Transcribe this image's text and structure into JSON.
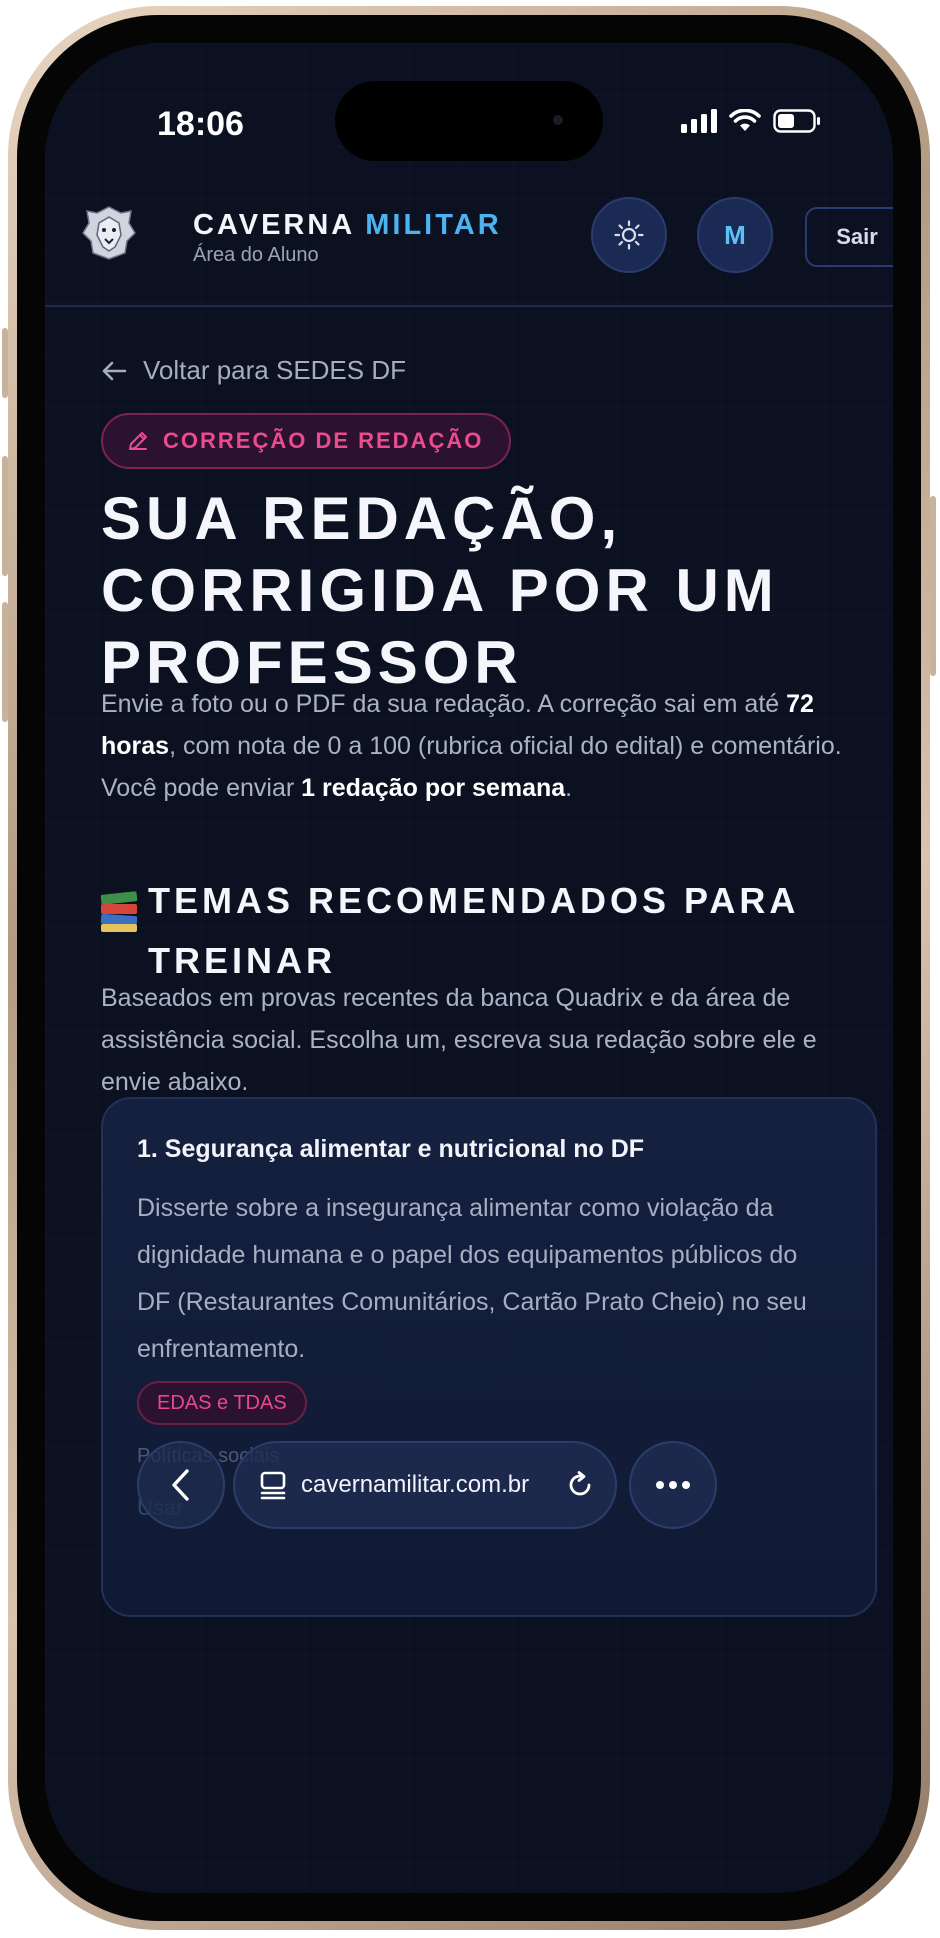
{
  "status_bar": {
    "time": "18:06"
  },
  "header": {
    "brand_part1": "CAVERNA",
    "brand_part2": "MILITAR",
    "subtitle": "Área do Aluno",
    "avatar_initial": "M",
    "logout_label": "Sair"
  },
  "back_link": {
    "label": "Voltar para SEDES DF"
  },
  "tag": {
    "label": "CORREÇÃO DE REDAÇÃO"
  },
  "title": {
    "line1": "SUA REDAÇÃO,",
    "line2": "CORRIGIDA POR UM",
    "line3": "PROFESSOR"
  },
  "intro": {
    "part1": "Envie a foto ou o PDF da sua redação. A correção sai em até ",
    "bold1": "72 horas",
    "part2": ", com nota de 0 a 100 (rubrica oficial do edital) e comentário. Você pode enviar ",
    "bold2": "1 redação por semana",
    "part3": "."
  },
  "section": {
    "title": "TEMAS RECOMENDADOS PARA TREINAR",
    "description": "Baseados em provas recentes da banca Quadrix e da área de assistência social. Escolha um, escreva sua redação sobre ele e envie abaixo."
  },
  "topics": [
    {
      "title": "1. Segurança alimentar e nutricional no DF",
      "description": "Disserte sobre a insegurança alimentar como violação da dignidade humana e o papel dos equipamentos públicos do DF (Restaurantes Comunitários, Cartão Prato Cheio) no seu enfrentamento.",
      "tag": "EDAS e TDAS",
      "meta": "Políticas sociais",
      "action": "Usar"
    }
  ],
  "browser": {
    "url": "cavernamilitar.com.br"
  },
  "colors": {
    "background": "#0b1120",
    "accent_blue": "#4db3f0",
    "accent_pink": "#ec4b8d",
    "card_bg": "#14203f"
  }
}
